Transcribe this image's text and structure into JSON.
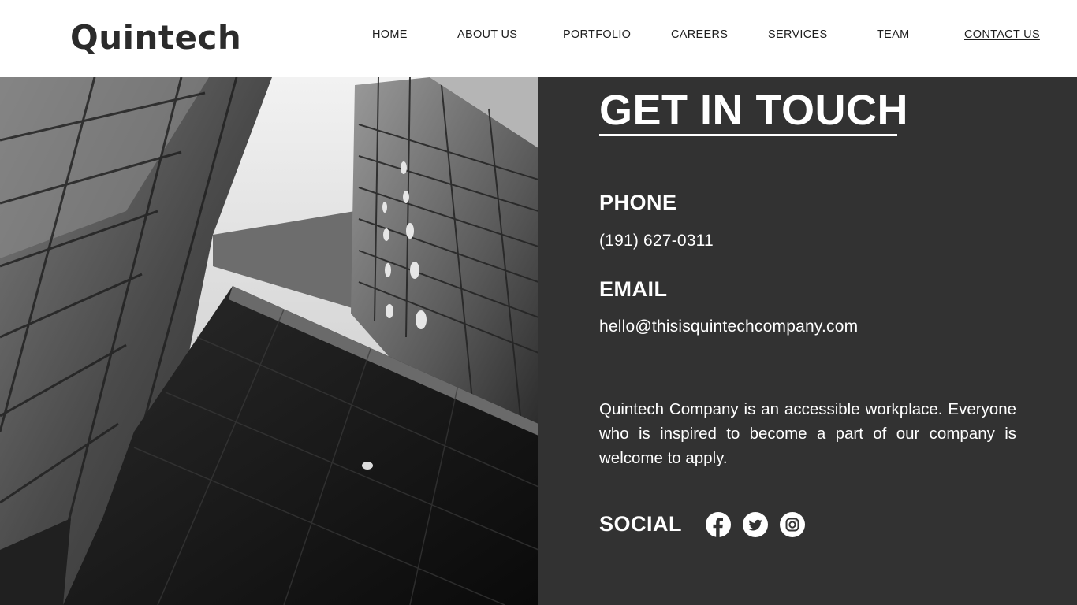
{
  "header": {
    "logo": "Quintech",
    "nav": [
      {
        "label": "HOME"
      },
      {
        "label": "ABOUT US"
      },
      {
        "label": "PORTFOLIO"
      },
      {
        "label": "CAREERS"
      },
      {
        "label": "SERVICES"
      },
      {
        "label": "TEAM"
      },
      {
        "label": "CONTACT US",
        "active": true
      }
    ]
  },
  "hero_image": {
    "alt": "Black and white photo of modern glass office buildings viewed from below"
  },
  "contact": {
    "title": "GET IN TOUCH",
    "phone_label": "PHONE",
    "phone_value": "(191) 627-0311",
    "email_label": "EMAIL",
    "email_value": "hello@thisisquintechcompany.com",
    "description": "Quintech Company is an accessible workplace. Everyone who is inspired to become a part of our company is welcome to apply.",
    "social_label": "SOCIAL",
    "social_icons": [
      "facebook-icon",
      "twitter-icon",
      "instagram-icon"
    ]
  },
  "colors": {
    "panel_bg": "#323232",
    "header_bg": "#ffffff",
    "text_dark": "#2b2b2b",
    "text_light": "#ffffff"
  }
}
